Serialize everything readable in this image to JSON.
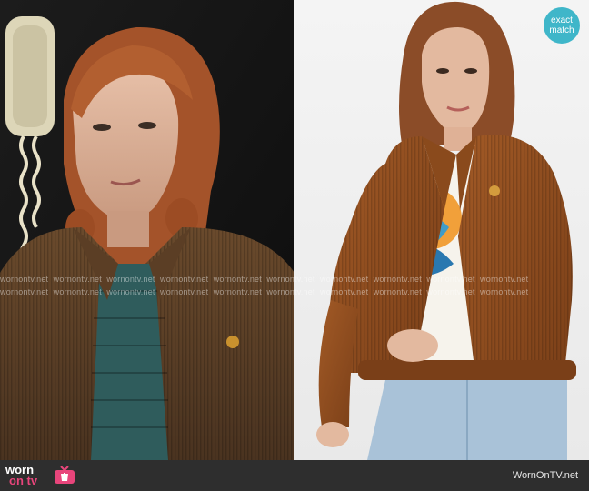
{
  "watermark": {
    "text": "wornontv.net"
  },
  "badge": {
    "line1": "exact",
    "line2": "match",
    "color": "#3fb6c9"
  },
  "footer": {
    "logo_word1": "worn",
    "logo_word2": "on tv",
    "logo_accent": "#e8457b",
    "site": "WornOnTV.net"
  },
  "photos": [
    {
      "subject": "character-in-corduroy-jacket"
    },
    {
      "subject": "model-in-corduroy-jacket"
    }
  ]
}
